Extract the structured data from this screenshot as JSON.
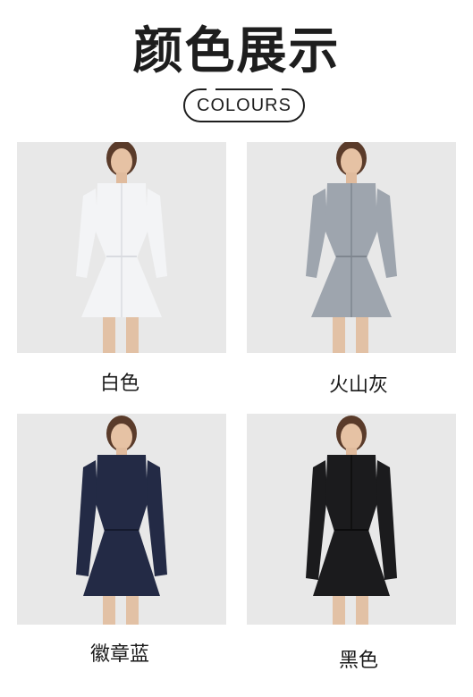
{
  "header": {
    "title": "颜色展示",
    "subtitle": "COLOURS"
  },
  "colors": [
    {
      "label": "白色",
      "garment_color": "#f3f4f6",
      "shade_color": "#d9dbe0"
    },
    {
      "label": "火山灰",
      "garment_color": "#9ea5ae",
      "shade_color": "#7f868f"
    },
    {
      "label": "徽章蓝",
      "garment_color": "#232a45",
      "shade_color": "#151a2e"
    },
    {
      "label": "黑色",
      "garment_color": "#1b1b1d",
      "shade_color": "#0c0c0d"
    }
  ]
}
